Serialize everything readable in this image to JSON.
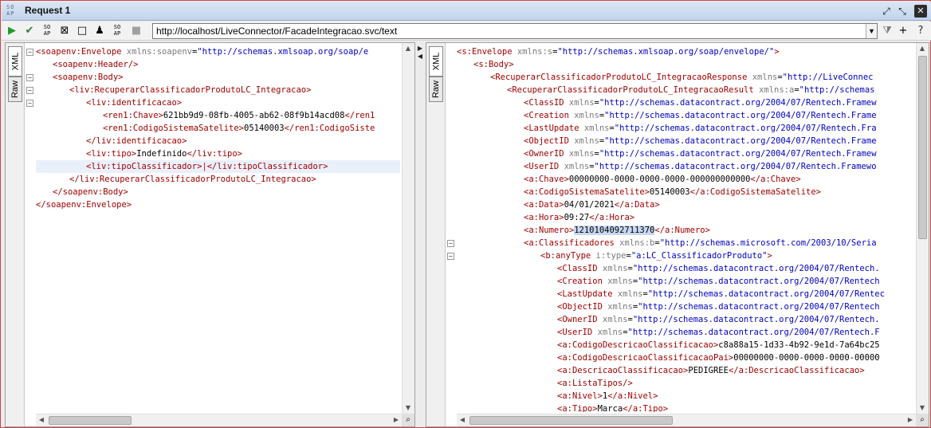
{
  "window": {
    "logo_text": "SO AP",
    "title": "Request 1"
  },
  "toolbar": {
    "endpoint_url": "http://localhost/LiveConnector/FacadeIntegracao.svc/text",
    "icons": [
      "play-icon",
      "check-icon",
      "soap-icon",
      "fit-icon",
      "square-icon",
      "user-icon",
      "soap-doc-icon",
      "stop-icon"
    ],
    "right_icons": [
      "filter-icon",
      "plus-icon",
      "help-icon"
    ]
  },
  "request_panel": {
    "tabs": [
      "XML",
      "Raw"
    ],
    "lines": [
      {
        "indent": 0,
        "parts": [
          [
            "tag",
            "<soapenv:Envelope "
          ],
          [
            "attr",
            "xmlns:soapenv"
          ],
          [
            "txt",
            "="
          ],
          [
            "val",
            "\"http://schemas.xmlsoap.org/soap/e"
          ]
        ]
      },
      {
        "indent": 1,
        "parts": [
          [
            "tag",
            "<soapenv:Header/>"
          ]
        ]
      },
      {
        "indent": 1,
        "parts": [
          [
            "tag",
            "<soapenv:Body>"
          ]
        ]
      },
      {
        "indent": 2,
        "parts": [
          [
            "tag",
            "<liv:RecuperarClassificadorProdutoLC_Integracao>"
          ]
        ]
      },
      {
        "indent": 3,
        "parts": [
          [
            "tag",
            "<liv:identificacao>"
          ]
        ]
      },
      {
        "indent": 4,
        "parts": [
          [
            "tag",
            "<ren1:Chave>"
          ],
          [
            "txt",
            "621bb9d9-08fb-4005-ab62-08f9b14acd08"
          ],
          [
            "tag",
            "</ren1"
          ]
        ]
      },
      {
        "indent": 4,
        "parts": [
          [
            "tag",
            "<ren1:CodigoSistemaSatelite>"
          ],
          [
            "txt",
            "05140003"
          ],
          [
            "tag",
            "</ren1:CodigoSiste"
          ]
        ]
      },
      {
        "indent": 3,
        "parts": [
          [
            "tag",
            "</liv:identificacao>"
          ]
        ]
      },
      {
        "indent": 3,
        "parts": [
          [
            "tag",
            "<liv:tipo>"
          ],
          [
            "txt",
            "Indefinido"
          ],
          [
            "tag",
            "</liv:tipo>"
          ]
        ]
      },
      {
        "indent": 3,
        "parts": [
          [
            "tag",
            "<liv:tipoClassificador>"
          ],
          [
            "caret",
            "|"
          ],
          [
            "tag",
            "</liv:tipoClassificador>"
          ]
        ],
        "current": true
      },
      {
        "indent": 2,
        "parts": [
          [
            "tag",
            "</liv:RecuperarClassificadorProdutoLC_Integracao>"
          ]
        ]
      },
      {
        "indent": 1,
        "parts": [
          [
            "tag",
            "</soapenv:Body>"
          ]
        ]
      },
      {
        "indent": 0,
        "parts": [
          [
            "tag",
            "</soapenv:Envelope>"
          ]
        ]
      }
    ]
  },
  "response_panel": {
    "tabs": [
      "XML",
      "Raw"
    ],
    "lines": [
      {
        "indent": 0,
        "parts": [
          [
            "tag",
            "<s:Envelope "
          ],
          [
            "attr",
            "xmlns:s"
          ],
          [
            "txt",
            "="
          ],
          [
            "val",
            "\"http://schemas.xmlsoap.org/soap/envelope/\""
          ],
          [
            "tag",
            ">"
          ]
        ]
      },
      {
        "indent": 1,
        "parts": [
          [
            "tag",
            "<s:Body>"
          ]
        ]
      },
      {
        "indent": 2,
        "parts": [
          [
            "tag",
            "<RecuperarClassificadorProdutoLC_IntegracaoResponse "
          ],
          [
            "attr",
            "xmlns"
          ],
          [
            "txt",
            "="
          ],
          [
            "val",
            "\"http://LiveConnec"
          ]
        ]
      },
      {
        "indent": 3,
        "parts": [
          [
            "tag",
            "<RecuperarClassificadorProdutoLC_IntegracaoResult "
          ],
          [
            "attr",
            "xmlns:a"
          ],
          [
            "txt",
            "="
          ],
          [
            "val",
            "\"http://schemas"
          ]
        ]
      },
      {
        "indent": 4,
        "parts": [
          [
            "tag",
            "<ClassID "
          ],
          [
            "attr",
            "xmlns"
          ],
          [
            "txt",
            "="
          ],
          [
            "val",
            "\"http://schemas.datacontract.org/2004/07/Rentech.Framew"
          ]
        ]
      },
      {
        "indent": 4,
        "parts": [
          [
            "tag",
            "<Creation "
          ],
          [
            "attr",
            "xmlns"
          ],
          [
            "txt",
            "="
          ],
          [
            "val",
            "\"http://schemas.datacontract.org/2004/07/Rentech.Frame"
          ]
        ]
      },
      {
        "indent": 4,
        "parts": [
          [
            "tag",
            "<LastUpdate "
          ],
          [
            "attr",
            "xmlns"
          ],
          [
            "txt",
            "="
          ],
          [
            "val",
            "\"http://schemas.datacontract.org/2004/07/Rentech.Fra"
          ]
        ]
      },
      {
        "indent": 4,
        "parts": [
          [
            "tag",
            "<ObjectID "
          ],
          [
            "attr",
            "xmlns"
          ],
          [
            "txt",
            "="
          ],
          [
            "val",
            "\"http://schemas.datacontract.org/2004/07/Rentech.Frame"
          ]
        ]
      },
      {
        "indent": 4,
        "parts": [
          [
            "tag",
            "<OwnerID "
          ],
          [
            "attr",
            "xmlns"
          ],
          [
            "txt",
            "="
          ],
          [
            "val",
            "\"http://schemas.datacontract.org/2004/07/Rentech.Framew"
          ]
        ]
      },
      {
        "indent": 4,
        "parts": [
          [
            "tag",
            "<UserID "
          ],
          [
            "attr",
            "xmlns"
          ],
          [
            "txt",
            "="
          ],
          [
            "val",
            "\"http://schemas.datacontract.org/2004/07/Rentech.Framewo"
          ]
        ]
      },
      {
        "indent": 4,
        "parts": [
          [
            "tag",
            "<a:Chave>"
          ],
          [
            "txt",
            "00000000-0000-0000-0000-000000000000"
          ],
          [
            "tag",
            "</a:Chave>"
          ]
        ]
      },
      {
        "indent": 4,
        "parts": [
          [
            "tag",
            "<a:CodigoSistemaSatelite>"
          ],
          [
            "txt",
            "05140003"
          ],
          [
            "tag",
            "</a:CodigoSistemaSatelite>"
          ]
        ]
      },
      {
        "indent": 4,
        "parts": [
          [
            "tag",
            "<a:Data>"
          ],
          [
            "txt",
            "04/01/2021"
          ],
          [
            "tag",
            "</a:Data>"
          ]
        ]
      },
      {
        "indent": 4,
        "parts": [
          [
            "tag",
            "<a:Hora>"
          ],
          [
            "txt",
            "09:27"
          ],
          [
            "tag",
            "</a:Hora>"
          ]
        ]
      },
      {
        "indent": 4,
        "parts": [
          [
            "tag",
            "<a:Numero>"
          ],
          [
            "hl",
            "1210104092711370"
          ],
          [
            "tag",
            "</a:Numero>"
          ]
        ]
      },
      {
        "indent": 4,
        "parts": [
          [
            "tag",
            "<a:Classificadores "
          ],
          [
            "attr",
            "xmlns:b"
          ],
          [
            "txt",
            "="
          ],
          [
            "val",
            "\"http://schemas.microsoft.com/2003/10/Seria"
          ]
        ]
      },
      {
        "indent": 5,
        "parts": [
          [
            "tag",
            "<b:anyType "
          ],
          [
            "attr",
            "i:type"
          ],
          [
            "txt",
            "="
          ],
          [
            "val",
            "\"a:LC_ClassificadorProduto\""
          ],
          [
            "tag",
            ">"
          ]
        ]
      },
      {
        "indent": 6,
        "parts": [
          [
            "tag",
            "<ClassID "
          ],
          [
            "attr",
            "xmlns"
          ],
          [
            "txt",
            "="
          ],
          [
            "val",
            "\"http://schemas.datacontract.org/2004/07/Rentech."
          ]
        ]
      },
      {
        "indent": 6,
        "parts": [
          [
            "tag",
            "<Creation "
          ],
          [
            "attr",
            "xmlns"
          ],
          [
            "txt",
            "="
          ],
          [
            "val",
            "\"http://schemas.datacontract.org/2004/07/Rentech"
          ]
        ]
      },
      {
        "indent": 6,
        "parts": [
          [
            "tag",
            "<LastUpdate "
          ],
          [
            "attr",
            "xmlns"
          ],
          [
            "txt",
            "="
          ],
          [
            "val",
            "\"http://schemas.datacontract.org/2004/07/Rentec"
          ]
        ]
      },
      {
        "indent": 6,
        "parts": [
          [
            "tag",
            "<ObjectID "
          ],
          [
            "attr",
            "xmlns"
          ],
          [
            "txt",
            "="
          ],
          [
            "val",
            "\"http://schemas.datacontract.org/2004/07/Rentech"
          ]
        ]
      },
      {
        "indent": 6,
        "parts": [
          [
            "tag",
            "<OwnerID "
          ],
          [
            "attr",
            "xmlns"
          ],
          [
            "txt",
            "="
          ],
          [
            "val",
            "\"http://schemas.datacontract.org/2004/07/Rentech."
          ]
        ]
      },
      {
        "indent": 6,
        "parts": [
          [
            "tag",
            "<UserID "
          ],
          [
            "attr",
            "xmlns"
          ],
          [
            "txt",
            "="
          ],
          [
            "val",
            "\"http://schemas.datacontract.org/2004/07/Rentech.F"
          ]
        ]
      },
      {
        "indent": 6,
        "parts": [
          [
            "tag",
            "<a:CodigoDescricaoClassificacao>"
          ],
          [
            "txt",
            "c8a88a15-1d33-4b92-9e1d-7a64bc25"
          ]
        ]
      },
      {
        "indent": 6,
        "parts": [
          [
            "tag",
            "<a:CodigoDescricaoClassificacaoPai>"
          ],
          [
            "txt",
            "00000000-0000-0000-0000-00000"
          ]
        ]
      },
      {
        "indent": 6,
        "parts": [
          [
            "tag",
            "<a:DescricaoClassificacao>"
          ],
          [
            "txt",
            "PEDIGREE"
          ],
          [
            "tag",
            "</a:DescricaoClassificacao>"
          ]
        ]
      },
      {
        "indent": 6,
        "parts": [
          [
            "tag",
            "<a:ListaTipos/>"
          ]
        ]
      },
      {
        "indent": 6,
        "parts": [
          [
            "tag",
            "<a:Nivel>"
          ],
          [
            "txt",
            "1"
          ],
          [
            "tag",
            "</a:Nivel>"
          ]
        ]
      },
      {
        "indent": 6,
        "parts": [
          [
            "tag",
            "<a:Tipo>"
          ],
          [
            "txt",
            "Marca"
          ],
          [
            "tag",
            "</a:Tipo>"
          ]
        ]
      }
    ]
  }
}
